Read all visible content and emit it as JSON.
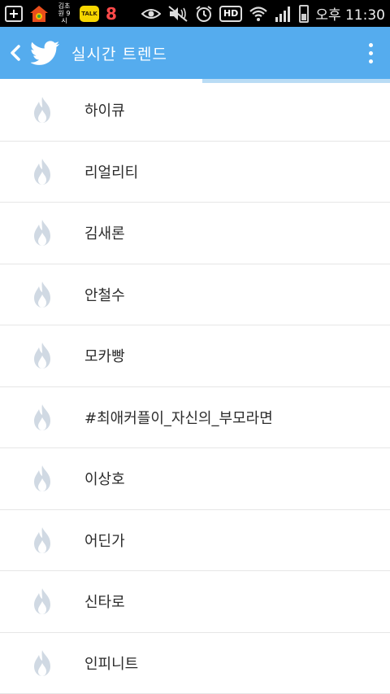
{
  "status_bar": {
    "app_glyph": "8",
    "kakao_label": "TALK",
    "small_text": "김초원 9시",
    "hd_label": "HD",
    "clock": "오후 11:30"
  },
  "app_bar": {
    "title": "실시간 트렌드",
    "color": "#55acee"
  },
  "trends": [
    {
      "label": "하이큐"
    },
    {
      "label": "리얼리티"
    },
    {
      "label": "김새론"
    },
    {
      "label": "안철수"
    },
    {
      "label": "모카빵"
    },
    {
      "label": "#최애커플이_자신의_부모라면"
    },
    {
      "label": "이상호"
    },
    {
      "label": "어딘가"
    },
    {
      "label": "신타로"
    },
    {
      "label": "인피니트"
    }
  ],
  "icons": {
    "back": "chevron-left-icon",
    "logo": "twitter-bird-icon",
    "menu": "overflow-menu-icon",
    "trend": "flame-icon"
  }
}
